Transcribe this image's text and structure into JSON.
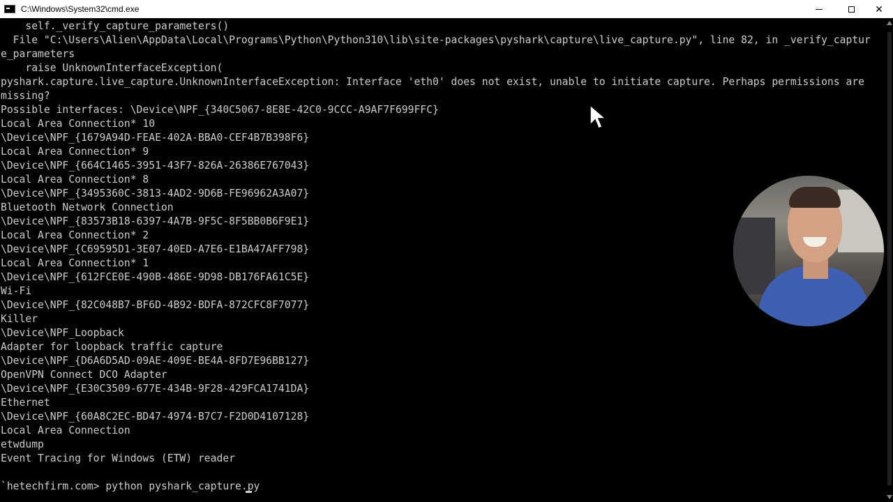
{
  "window": {
    "title": "C:\\Windows\\System32\\cmd.exe",
    "close_glyph": "✕"
  },
  "console": {
    "lines": [
      "    self._verify_capture_parameters()",
      "  File \"C:\\Users\\Alien\\AppData\\Local\\Programs\\Python\\Python310\\lib\\site-packages\\pyshark\\capture\\live_capture.py\", line 82, in _verify_captur",
      "e_parameters",
      "    raise UnknownInterfaceException(",
      "pyshark.capture.live_capture.UnknownInterfaceException: Interface 'eth0' does not exist, unable to initiate capture. Perhaps permissions are",
      "missing?",
      "Possible interfaces: \\Device\\NPF_{340C5067-8E8E-42C0-9CCC-A9AF7F699FFC}",
      "Local Area Connection* 10",
      "\\Device\\NPF_{1679A94D-FEAE-402A-BBA0-CEF4B7B398F6}",
      "Local Area Connection* 9",
      "\\Device\\NPF_{664C1465-3951-43F7-826A-26386E767043}",
      "Local Area Connection* 8",
      "\\Device\\NPF_{3495360C-3813-4AD2-9D6B-FE96962A3A07}",
      "Bluetooth Network Connection",
      "\\Device\\NPF_{83573B18-6397-4A7B-9F5C-8F5BB0B6F9E1}",
      "Local Area Connection* 2",
      "\\Device\\NPF_{C69595D1-3E07-40ED-A7E6-E1BA47AFF798}",
      "Local Area Connection* 1",
      "\\Device\\NPF_{612FCE0E-490B-486E-9D98-DB176FA61C5E}",
      "Wi-Fi",
      "\\Device\\NPF_{82C048B7-BF6D-4B92-BDFA-872CFC8F7077}",
      "Killer",
      "\\Device\\NPF_Loopback",
      "Adapter for loopback traffic capture",
      "\\Device\\NPF_{D6A6D5AD-09AE-409E-BE4A-8FD7E96BB127}",
      "OpenVPN Connect DCO Adapter",
      "\\Device\\NPF_{E30C3509-677E-434B-9F28-429FCA1741DA}",
      "Ethernet",
      "\\Device\\NPF_{60A8C2EC-BD47-4974-B7C7-F2D0D4107128}",
      "Local Area Connection",
      "etwdump",
      "Event Tracing for Windows (ETW) reader",
      "",
      "`hetechfirm.com> python pyshark_capture.py"
    ]
  },
  "colors": {
    "background": "#000000",
    "text": "#cccccc",
    "titlebar": "#ffffff"
  },
  "icons": {
    "window_icon": "cmd-icon",
    "minimize": "minimize-icon",
    "maximize": "maximize-icon",
    "close": "close-icon",
    "pointer": "mouse-pointer-icon"
  }
}
